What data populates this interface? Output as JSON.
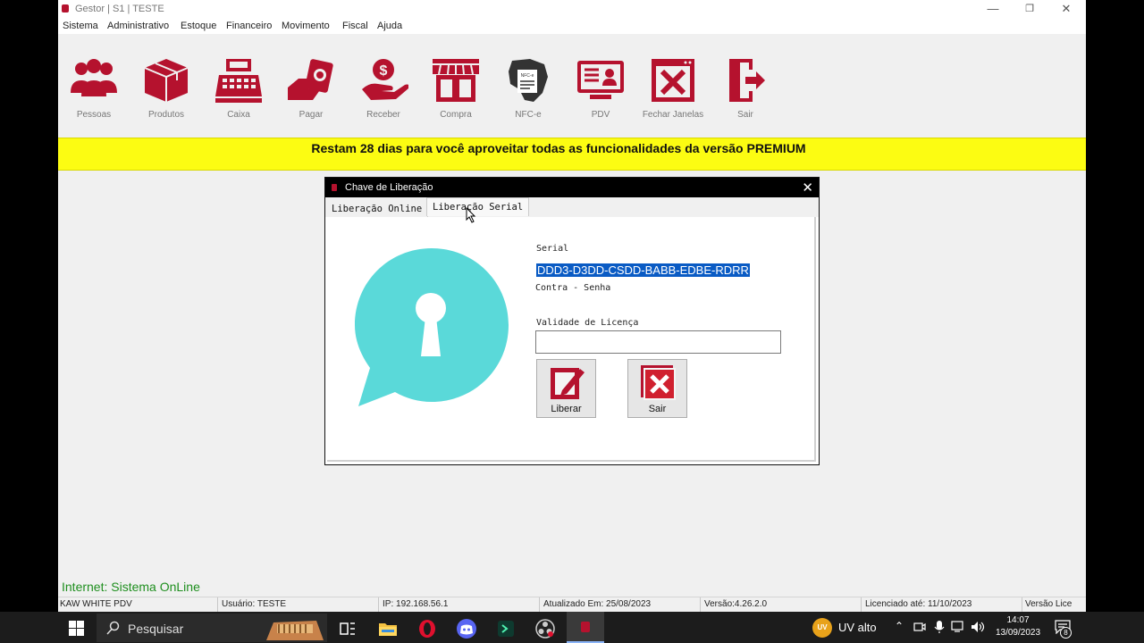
{
  "window": {
    "title": "Gestor | S1 | TESTE",
    "minimize": "—",
    "restore": "❐",
    "close": "✕"
  },
  "menu": [
    "Sistema",
    "Administrativo",
    "Estoque",
    "Financeiro",
    "Movimento",
    "Fiscal",
    "Ajuda"
  ],
  "toolbar": [
    {
      "label": "Pessoas",
      "icon": "people-icon"
    },
    {
      "label": "Produtos",
      "icon": "box-icon"
    },
    {
      "label": "Caixa",
      "icon": "cash-register-icon"
    },
    {
      "label": "Pagar",
      "icon": "pay-icon"
    },
    {
      "label": "Receber",
      "icon": "receive-icon"
    },
    {
      "label": "Compra",
      "icon": "store-icon"
    },
    {
      "label": "NFC-e",
      "icon": "nfce-icon",
      "badge": "NFC-e"
    },
    {
      "label": "PDV",
      "icon": "pdv-icon"
    },
    {
      "label": "Fechar Janelas",
      "icon": "close-windows-icon"
    },
    {
      "label": "Sair",
      "icon": "exit-icon"
    }
  ],
  "banner": "Restam 28 dias para você aproveitar todas as funcionalidades da versão PREMIUM",
  "dialog": {
    "title": "Chave de Liberação",
    "close": "✕",
    "tabs": [
      "Liberação Online",
      "Liberação Serial"
    ],
    "active_tab": "Liberação Serial",
    "serial_label": "Serial",
    "serial_value": "DDD3-D3DD-CSDD-BABB-EDBE-RDRR",
    "contra_senha_label": "Contra - Senha",
    "validade_label": "Validade de Licença",
    "validade_value": "",
    "liberar_label": "Liberar",
    "sair_label": "Sair"
  },
  "internet_status": "Internet: Sistema OnLine",
  "status": {
    "company": "KAW WHITE PDV",
    "user": "Usuário: TESTE",
    "ip": "IP: 192.168.56.1",
    "updated": "Atualizado Em: 25/08/2023",
    "version": "Versão:4.26.2.0",
    "license": "Licenciado até: 11/10/2023",
    "version_license": "Versão Lice"
  },
  "taskbar": {
    "search_placeholder": "Pesquisar",
    "weather": "UV alto",
    "weather_badge": "UV",
    "time": "14:07",
    "date": "13/09/2023",
    "notification_count": "8"
  },
  "colors": {
    "brand_red": "#b5122e",
    "banner_yellow": "#fcfc12",
    "lock_teal": "#5ad9d9",
    "selection_blue": "#0a5bc4",
    "online_green": "#1f8f1f"
  }
}
